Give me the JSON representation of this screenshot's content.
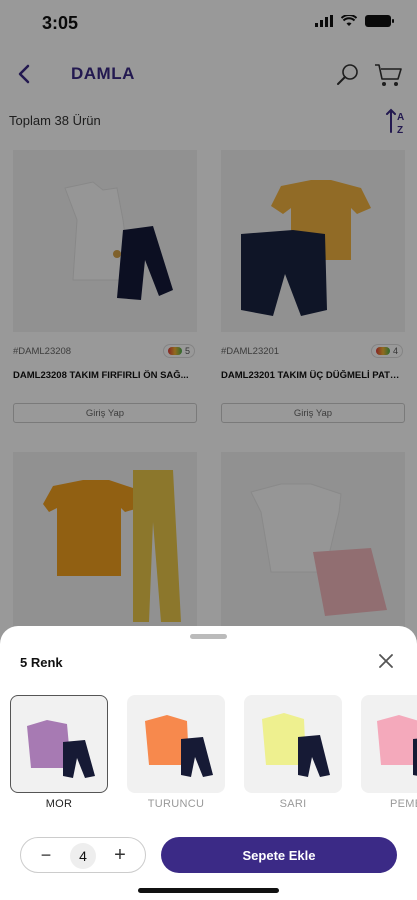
{
  "status": {
    "time": "3:05"
  },
  "header": {
    "title": "DAMLA"
  },
  "list": {
    "count_text": "Toplam 38 Ürün"
  },
  "products": [
    {
      "code": "#DAML23208",
      "colors": "5",
      "name": "DAML23208 TAKIM FIRFIRLI ÖN SAĞ...",
      "button": "Giriş Yap"
    },
    {
      "code": "#DAML23201",
      "colors": "4",
      "name": "DAML23201 TAKIM ÜÇ DÜĞMELİ PATLI...",
      "button": "Giriş Yap"
    },
    {
      "code": "",
      "colors": "",
      "name": "",
      "button": ""
    },
    {
      "code": "",
      "colors": "",
      "name": "",
      "button": ""
    }
  ],
  "sheet": {
    "title": "5 Renk",
    "swatches": [
      {
        "label": "MOR",
        "color": "#a77ab3"
      },
      {
        "label": "TURUNCU",
        "color": "#f7894d"
      },
      {
        "label": "SARI",
        "color": "#eef08f"
      },
      {
        "label": "PEMBE",
        "color": "#f4a9bb"
      }
    ],
    "quantity": "4",
    "add_label": "Sepete Ekle"
  },
  "colors": {
    "brand": "#3b2a86"
  }
}
